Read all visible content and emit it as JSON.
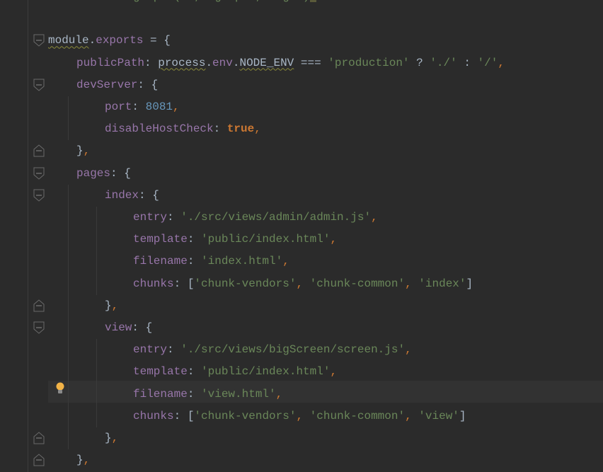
{
  "editor": {
    "colors": {
      "background": "#2b2b2b",
      "property": "#9876aa",
      "string": "#6a8759",
      "number": "#6897bb",
      "keyword": "#cc7832",
      "text": "#a9b7c6"
    },
    "current_line_index": 16,
    "lines": [
      {
        "indent": 3,
        "tokens": [
          {
            "t": "g  p  (  ,  g  p  ,   g  )",
            "c": "s"
          }
        ],
        "caret": true
      },
      {
        "indent": 0,
        "tokens": []
      },
      {
        "indent": 0,
        "fold": "open",
        "tokens": [
          {
            "t": "module",
            "c": "d u"
          },
          {
            "t": ".",
            "c": "d"
          },
          {
            "t": "exports",
            "c": "k"
          },
          {
            "t": " = {",
            "c": "d"
          }
        ]
      },
      {
        "indent": 1,
        "tokens": [
          {
            "t": "publicPath",
            "c": "k"
          },
          {
            "t": ": ",
            "c": "d"
          },
          {
            "t": "process",
            "c": "d u"
          },
          {
            "t": ".",
            "c": "d"
          },
          {
            "t": "env",
            "c": "k"
          },
          {
            "t": ".",
            "c": "d"
          },
          {
            "t": "NODE_ENV",
            "c": "d u"
          },
          {
            "t": " === ",
            "c": "d"
          },
          {
            "t": "'production'",
            "c": "s"
          },
          {
            "t": " ? ",
            "c": "d"
          },
          {
            "t": "'./'",
            "c": "s"
          },
          {
            "t": " : ",
            "c": "d"
          },
          {
            "t": "'/'",
            "c": "s"
          },
          {
            "t": ",",
            "c": "p"
          }
        ]
      },
      {
        "indent": 1,
        "fold": "open",
        "tokens": [
          {
            "t": "devServer",
            "c": "k"
          },
          {
            "t": ": {",
            "c": "d"
          }
        ]
      },
      {
        "indent": 2,
        "tokens": [
          {
            "t": "port",
            "c": "k"
          },
          {
            "t": ": ",
            "c": "d"
          },
          {
            "t": "8081",
            "c": "n"
          },
          {
            "t": ",",
            "c": "p"
          }
        ]
      },
      {
        "indent": 2,
        "tokens": [
          {
            "t": "disableHostCheck",
            "c": "k"
          },
          {
            "t": ": ",
            "c": "d"
          },
          {
            "t": "true",
            "c": "kw"
          },
          {
            "t": ",",
            "c": "p"
          }
        ]
      },
      {
        "indent": 1,
        "fold": "close",
        "tokens": [
          {
            "t": "}",
            "c": "d"
          },
          {
            "t": ",",
            "c": "p"
          }
        ]
      },
      {
        "indent": 1,
        "fold": "open",
        "tokens": [
          {
            "t": "pages",
            "c": "k"
          },
          {
            "t": ": {",
            "c": "d"
          }
        ]
      },
      {
        "indent": 2,
        "fold": "open",
        "tokens": [
          {
            "t": "index",
            "c": "k"
          },
          {
            "t": ": {",
            "c": "d"
          }
        ]
      },
      {
        "indent": 3,
        "tokens": [
          {
            "t": "entry",
            "c": "k"
          },
          {
            "t": ": ",
            "c": "d"
          },
          {
            "t": "'./src/views/admin/admin.js'",
            "c": "s"
          },
          {
            "t": ",",
            "c": "p"
          }
        ]
      },
      {
        "indent": 3,
        "tokens": [
          {
            "t": "template",
            "c": "k"
          },
          {
            "t": ": ",
            "c": "d"
          },
          {
            "t": "'public/index.html'",
            "c": "s"
          },
          {
            "t": ",",
            "c": "p"
          }
        ]
      },
      {
        "indent": 3,
        "tokens": [
          {
            "t": "filename",
            "c": "k"
          },
          {
            "t": ": ",
            "c": "d"
          },
          {
            "t": "'index.html'",
            "c": "s"
          },
          {
            "t": ",",
            "c": "p"
          }
        ]
      },
      {
        "indent": 3,
        "tokens": [
          {
            "t": "chunks",
            "c": "k"
          },
          {
            "t": ": [",
            "c": "d"
          },
          {
            "t": "'chunk-vendors'",
            "c": "s"
          },
          {
            "t": ", ",
            "c": "p"
          },
          {
            "t": "'chunk-common'",
            "c": "s"
          },
          {
            "t": ", ",
            "c": "p"
          },
          {
            "t": "'index'",
            "c": "s"
          },
          {
            "t": "]",
            "c": "d"
          }
        ]
      },
      {
        "indent": 2,
        "fold": "close",
        "tokens": [
          {
            "t": "}",
            "c": "d"
          },
          {
            "t": ",",
            "c": "p"
          }
        ]
      },
      {
        "indent": 2,
        "fold": "open",
        "tokens": [
          {
            "t": "view",
            "c": "k"
          },
          {
            "t": ": {",
            "c": "d"
          }
        ]
      },
      {
        "indent": 3,
        "tokens": [
          {
            "t": "entry",
            "c": "k"
          },
          {
            "t": ": ",
            "c": "d"
          },
          {
            "t": "'./src/views/bigScreen/screen.js'",
            "c": "s"
          },
          {
            "t": ",",
            "c": "p"
          }
        ]
      },
      {
        "indent": 3,
        "tokens": [
          {
            "t": "template",
            "c": "k"
          },
          {
            "t": ": ",
            "c": "d"
          },
          {
            "t": "'public/index.html'",
            "c": "s"
          },
          {
            "t": ",",
            "c": "p"
          }
        ]
      },
      {
        "indent": 3,
        "bulb": true,
        "tokens": [
          {
            "t": "filename",
            "c": "k"
          },
          {
            "t": ": ",
            "c": "d"
          },
          {
            "t": "'view.html'",
            "c": "s"
          },
          {
            "t": ",",
            "c": "p"
          }
        ]
      },
      {
        "indent": 3,
        "tokens": [
          {
            "t": "chunks",
            "c": "k"
          },
          {
            "t": ": [",
            "c": "d"
          },
          {
            "t": "'chunk-vendors'",
            "c": "s"
          },
          {
            "t": ", ",
            "c": "p"
          },
          {
            "t": "'chunk-common'",
            "c": "s"
          },
          {
            "t": ", ",
            "c": "p"
          },
          {
            "t": "'view'",
            "c": "s"
          },
          {
            "t": "]",
            "c": "d"
          }
        ]
      },
      {
        "indent": 2,
        "fold": "close",
        "tokens": [
          {
            "t": "}",
            "c": "d"
          },
          {
            "t": ",",
            "c": "p"
          }
        ]
      },
      {
        "indent": 1,
        "fold": "close",
        "tokens": [
          {
            "t": "}",
            "c": "d"
          },
          {
            "t": ",",
            "c": "p"
          }
        ]
      }
    ]
  }
}
